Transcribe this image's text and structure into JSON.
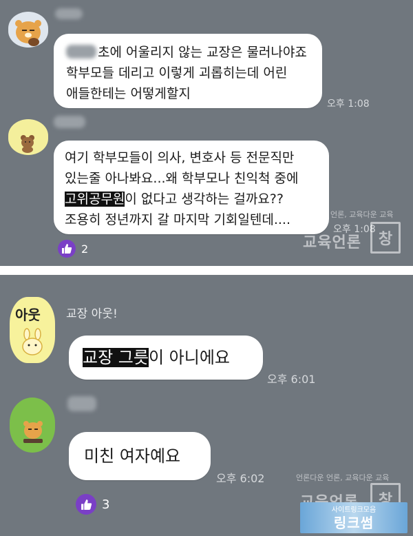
{
  "panel_top": {
    "messages": [
      {
        "text_before_blur": "",
        "text_line1": "초에 어울리지 않는 교장은 물러나야죠",
        "text_line2": "학부모들 데리고 이렇게 괴롭히는데 어린",
        "text_line3": "애들한테는 어떻게할지",
        "time": "오후 1:08"
      },
      {
        "line1": "여기 학부모들이 의사, 변호사 등 전문직만",
        "line2": "있는줄 아나봐요...왜 학부모나 친익척 중에",
        "line3_highlight": "고위공무원",
        "line3_rest": "이 없다고 생각하는 걸까요??",
        "line4": "조용히 정년까지 갈 마지막 기회일텐데....",
        "time": "오후 1:08",
        "reaction_count": "2"
      }
    ],
    "watermark": {
      "small": "언론, 교육다운 교육",
      "big": "교육언론",
      "box": "창"
    }
  },
  "panel_bottom": {
    "sender_name": "교장 아웃!",
    "avatar_text": "아웃",
    "messages": [
      {
        "highlight": "교장 그릇",
        "rest": "이 아니에요",
        "time": "오후 6:01"
      },
      {
        "text": "미친 여자예요",
        "time": "오후 6:02",
        "reaction_count": "3"
      }
    ],
    "watermark": {
      "small": "언론다운 언론, 교육다운 교육",
      "big": "교육언론",
      "box": "창"
    }
  },
  "corner_logo": {
    "small": "사이트링크모음",
    "big": "링크썸"
  },
  "colors": {
    "background": "#70777e",
    "bubble": "#ffffff",
    "reaction": "#7a3fc6"
  }
}
